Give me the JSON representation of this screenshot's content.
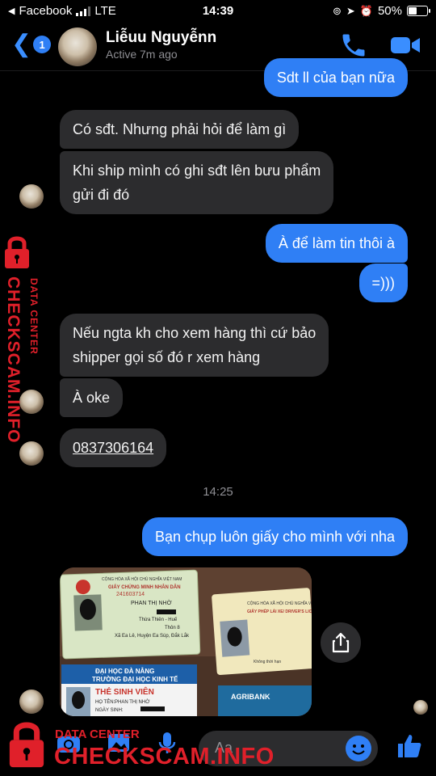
{
  "status_bar": {
    "back_app": "Facebook",
    "network": "LTE",
    "time": "14:39",
    "battery": "50%",
    "battery_level": 0.5
  },
  "header": {
    "back_badge": "1",
    "name": "Liễuu Nguyễnn",
    "status": "Active 7m ago"
  },
  "messages": [
    {
      "from": "me",
      "text": "Sdt ll của bạn nữa"
    },
    {
      "from": "them",
      "text": "Có sđt. Nhưng phải hỏi để làm gì"
    },
    {
      "from": "them",
      "lines": [
        "Khi ship mình có ghi sđt lên bưu phẩm",
        "gửi đi đó"
      ]
    },
    {
      "from": "me",
      "text": "À để làm tin thôi à"
    },
    {
      "from": "me",
      "text": "=)))"
    },
    {
      "from": "them",
      "lines": [
        "Nếu ngta kh cho xem hàng thì cứ bảo",
        "shipper gọi số đó r xem hàng"
      ]
    },
    {
      "from": "them",
      "text": "À oke"
    },
    {
      "from": "them",
      "text": "0837306164"
    },
    {
      "from": "me",
      "text": "Bạn chụp luôn giấy cho mình với nha"
    }
  ],
  "timestamp": "14:25",
  "photo": {
    "card1": {
      "header": "CỘNG HÒA XÃ HỘI CHỦ NGHĨA VIỆT NAM",
      "title": "GIẤY CHỨNG MINH NHÂN DÂN",
      "number": "241603714",
      "name": "PHAN THỊ NHỜ",
      "line1": "Thừa Thiên - Huế",
      "line2": "Thôn 8",
      "line3": "Xã Ea Lê, Huyện Ea Súp, Đắk Lắk"
    },
    "card2": {
      "uni": "ĐẠI HỌC ĐÀ NẴNG",
      "school": "TRƯỜNG ĐẠI HỌC KINH TẾ",
      "title": "THẺ SINH VIÊN",
      "name_label": "HỌ TÊN:",
      "name": "PHAN THỊ NHỜ",
      "birth_label": "NGÀY SINH:"
    },
    "card3": {
      "header": "CỘNG HÒA XÃ HỘI CHỦ NGHĨA VIỆT NAM",
      "title": "GIẤY PHÉP LÁI XE/ DRIVER'S LICENSE",
      "bank": "AGRIBANK",
      "note": "Không thời hạn"
    }
  },
  "composer": {
    "placeholder": "Aa"
  },
  "watermark": {
    "vertical_main": "CHECKSCAM.INFO",
    "vertical_sub": "DATA CENTER",
    "bottom_sub": "DATA CENTER",
    "bottom_main": "CHECKSCAM.INFO"
  },
  "colors": {
    "accent": "#2f7ff5",
    "incoming_bubble": "#2c2c2e",
    "watermark": "#e0202a"
  }
}
